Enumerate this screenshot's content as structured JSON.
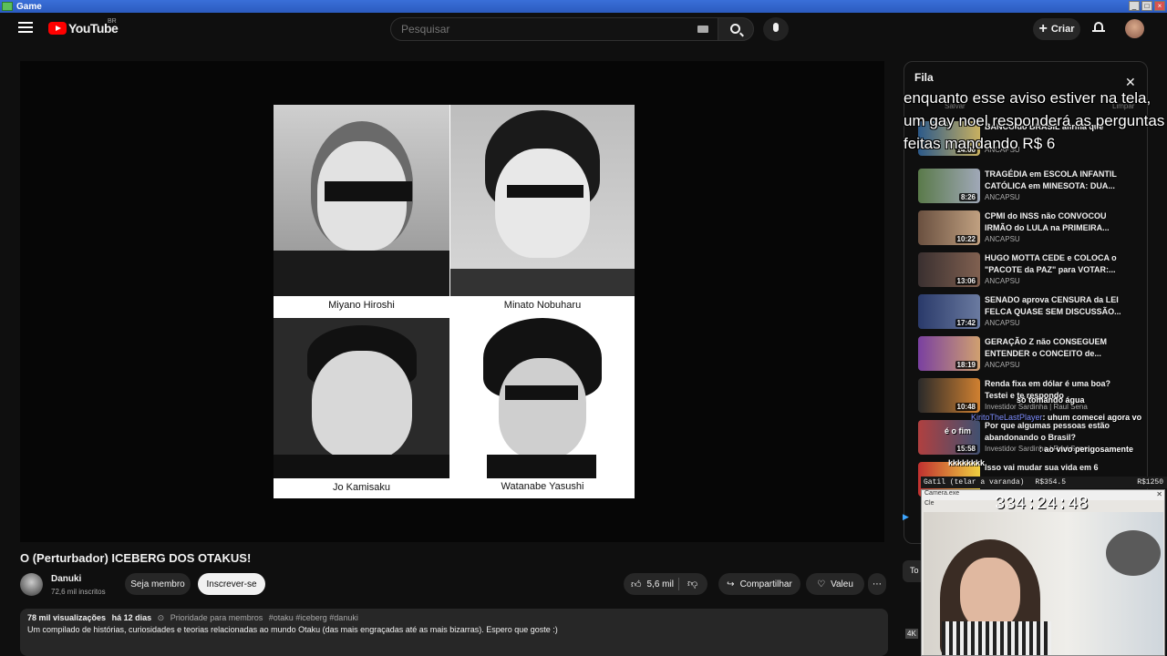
{
  "window": {
    "title": "Game"
  },
  "header": {
    "logo_text": "YouTube",
    "region": "BR",
    "search_placeholder": "Pesquisar",
    "create_label": "Criar"
  },
  "thumbnail_captions": [
    "Miyano Hiroshi",
    "Minato Nobuharu",
    "Jo Kamisaku",
    "Watanabe Yasushi"
  ],
  "video": {
    "title": "O (Perturbador) ICEBERG DOS OTAKUS!",
    "channel": "Danuki",
    "subscribers": "72,6 mil inscritos",
    "member_label": "Seja membro",
    "subscribe_label": "Inscrever-se",
    "likes": "5,6 mil",
    "share_label": "Compartilhar",
    "thanks_label": "Valeu",
    "views": "78 mil visualizações",
    "age": "há 12 dias",
    "priority": "Prioridade para membros",
    "tags": "#otaku #iceberg #danuki",
    "description": "Um compilado de histórias, curiosidades e teorias relacionadas ao mundo Otaku (das mais engraçadas até as mais bizarras). Espero que goste :)"
  },
  "queue": {
    "title": "Fila",
    "save_label": "Salvar",
    "clear_label": "Limpar",
    "items": [
      {
        "title": "BANCO do BRASIL afirma que",
        "channel": "ANCAPSU",
        "duration": "14:06"
      },
      {
        "title": "TRAGÉDIA em ESCOLA INFANTIL CATÓLICA em MINESOTA: DUA...",
        "channel": "ANCAPSU",
        "duration": "8:26"
      },
      {
        "title": "CPMI do INSS não CONVOCOU IRMÃO do LULA na PRIMEIRA...",
        "channel": "ANCAPSU",
        "duration": "10:22"
      },
      {
        "title": "HUGO MOTTA CEDE e COLOCA o \"PACOTE da PAZ\" para VOTAR:...",
        "channel": "ANCAPSU",
        "duration": "13:06"
      },
      {
        "title": "SENADO aprova CENSURA da LEI FELCA QUASE SEM DISCUSSÃO...",
        "channel": "ANCAPSU",
        "duration": "17:42"
      },
      {
        "title": "GERAÇÃO Z não CONSEGUEM ENTENDER o CONCEITO de...",
        "channel": "ANCAPSU",
        "duration": "18:19"
      },
      {
        "title": "Renda fixa em dólar é uma boa? Testei e te respondo",
        "channel": "Investidor Sardinha | Raul Sena",
        "duration": "10:48"
      },
      {
        "title": "Por que algumas pessoas estão abandonando o Brasil?",
        "channel": "Investidor Sardinha | Raul Sena",
        "duration": "15:58"
      },
      {
        "title": "Isso vai mudar sua vida em 6",
        "channel": "",
        "duration": ""
      }
    ]
  },
  "stream_overlay": {
    "alert_text": "enquanto esse aviso estiver na tela, um gay noel responderá as perguntas feitas mandando R$ 6",
    "chat": [
      {
        "user": "",
        "message": "só tomando água"
      },
      {
        "user": "KiritoTheLastPlayer",
        "message": ": uhum comecei agora vo"
      },
      {
        "user": "",
        "message": "é o fim"
      },
      {
        "user": "",
        "message": ": ao vivo perigosamente"
      },
      {
        "user": "",
        "message": "kkkkkkkk"
      }
    ],
    "goal_bar": {
      "label": "Gatil (telar a varanda)",
      "current": "R$354.5",
      "target": "R$1250"
    },
    "timer": "334:24:48",
    "cam_title": "Camera.exe",
    "cam_menu": "Cle"
  },
  "side": {
    "to_label": "To",
    "quality": "4K"
  }
}
